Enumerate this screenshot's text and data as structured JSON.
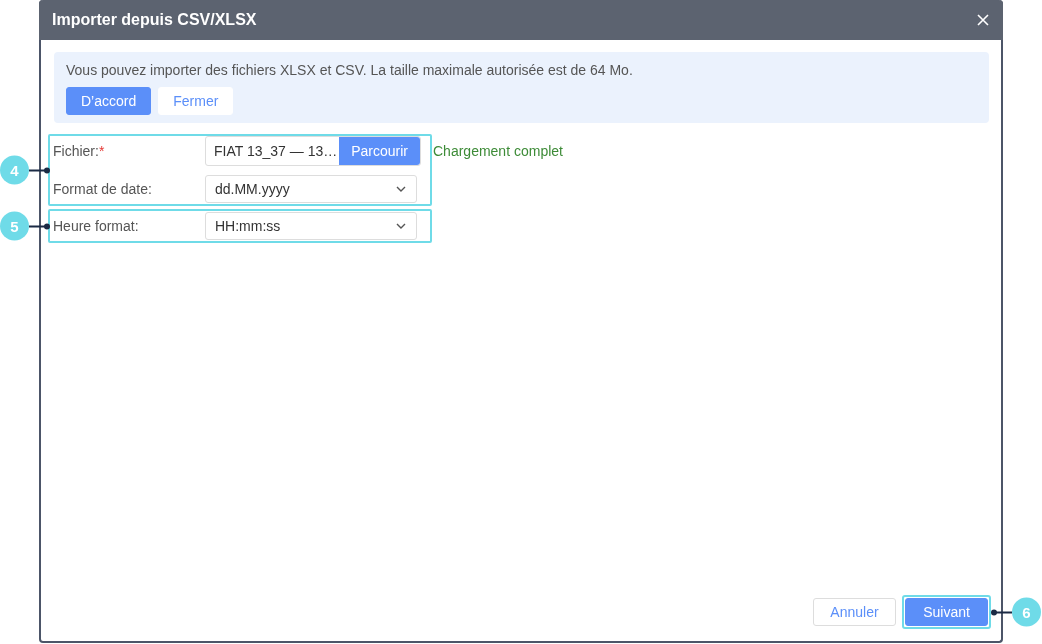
{
  "dialog": {
    "title": "Importer depuis CSV/XLSX",
    "notice": {
      "text": "Vous pouvez importer des fichiers XLSX et CSV. La taille maximale autorisée est de 64 Mo.",
      "buttons": [
        {
          "label": "D’accord",
          "kind": "primary"
        },
        {
          "label": "Fermer",
          "kind": "secondary"
        }
      ]
    },
    "form": {
      "groups": [
        {
          "callout": "4",
          "fields": [
            {
              "kind": "file",
              "label": "Fichier:",
              "required_mark": "*",
              "value": "FIAT 13_37 — 13…",
              "button": "Parcourir",
              "status": "Chargement complet"
            },
            {
              "kind": "select",
              "label": "Format de date:",
              "value": "dd.MM.yyyy"
            }
          ]
        },
        {
          "callout": "5",
          "fields": [
            {
              "kind": "select",
              "label": "Heure format:",
              "value": "HH:mm:ss"
            }
          ]
        }
      ]
    },
    "footer": {
      "buttons": [
        {
          "label": "Annuler",
          "kind": "secondary"
        },
        {
          "label": "Suivant",
          "kind": "primary",
          "callout": "6"
        }
      ]
    }
  }
}
